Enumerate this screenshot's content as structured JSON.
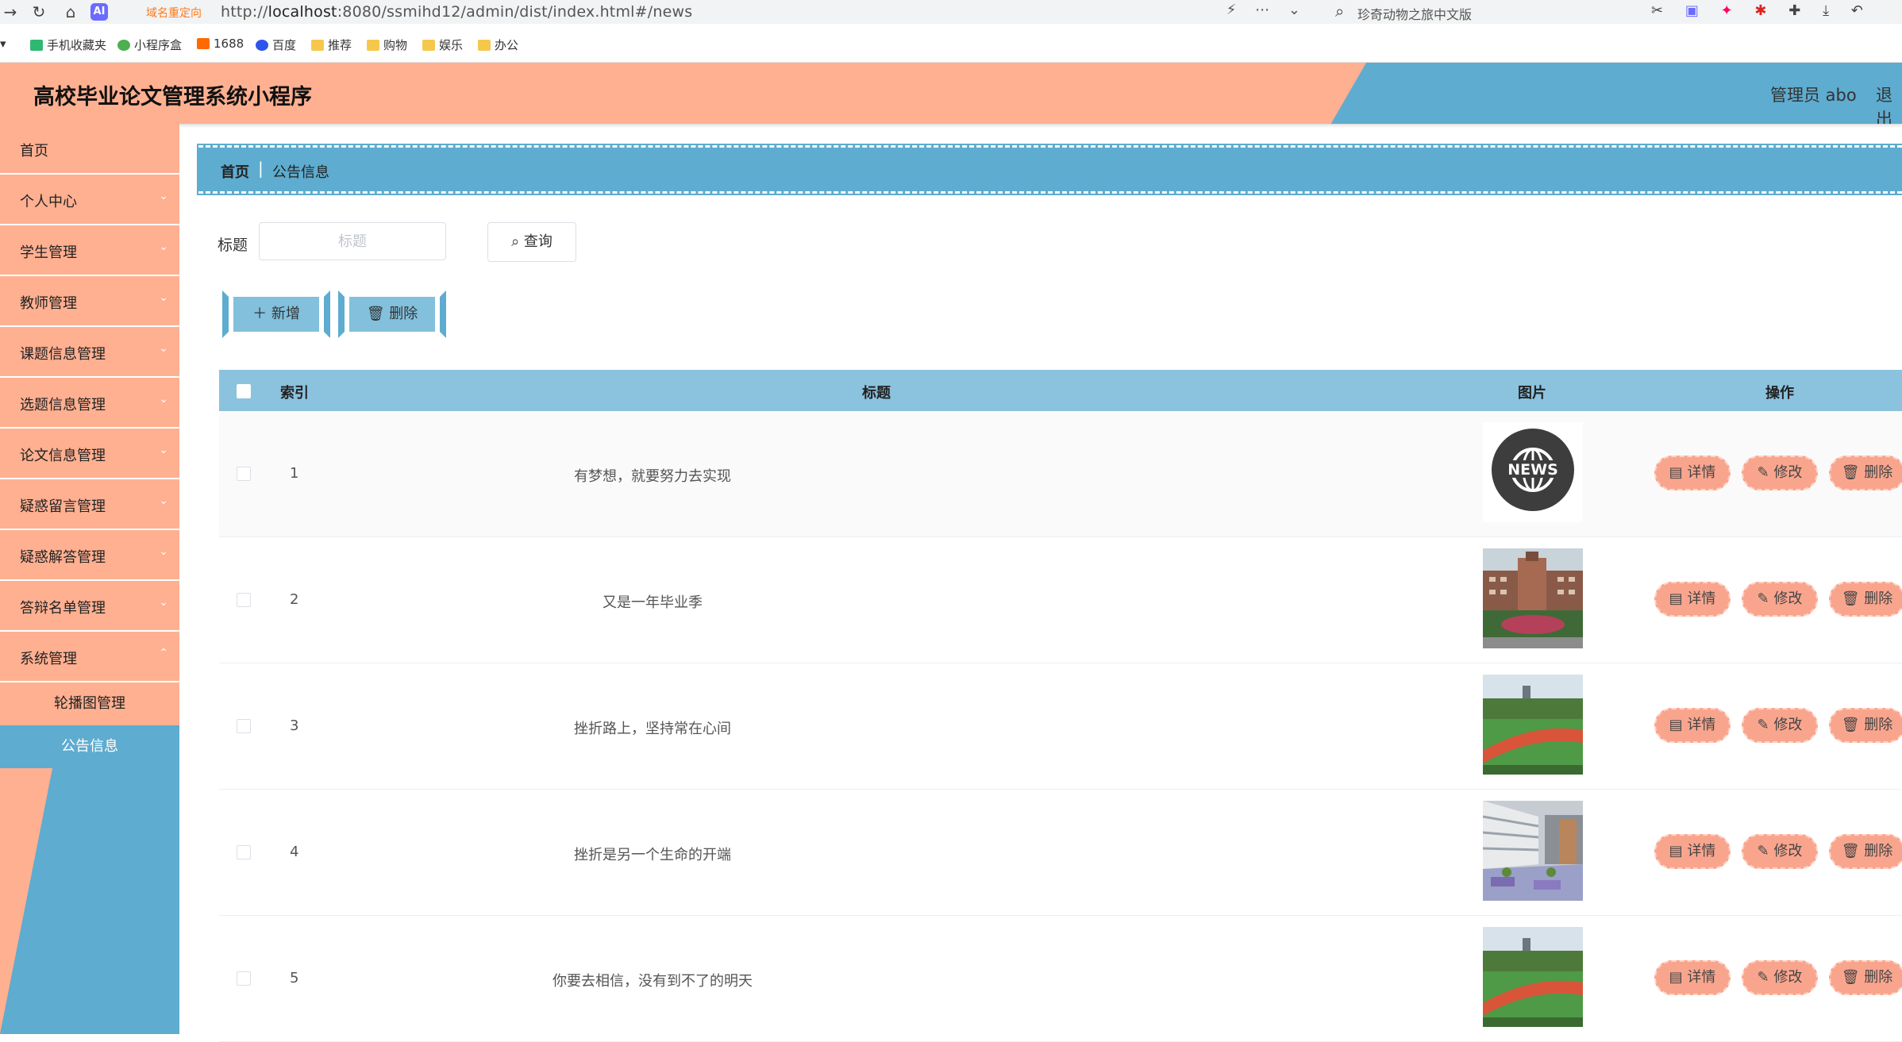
{
  "browser": {
    "redirect_label": "域名重定向",
    "url_prefix": "http://",
    "url_host": "localhost",
    "url_rest": ":8080/ssmihd12/admin/dist/index.html#/news",
    "search_text": "珍奇动物之旅中文版",
    "bookmarks": [
      {
        "label": "手机收藏夹",
        "icon": "phone-icon"
      },
      {
        "label": "小程序盒",
        "icon": "miniapp-icon"
      },
      {
        "label": "1688",
        "icon": "1688-icon"
      },
      {
        "label": "百度",
        "icon": "baidu-icon"
      },
      {
        "label": "推荐",
        "icon": "folder-icon"
      },
      {
        "label": "购物",
        "icon": "folder-icon"
      },
      {
        "label": "娱乐",
        "icon": "folder-icon"
      },
      {
        "label": "办公",
        "icon": "folder-icon"
      }
    ]
  },
  "header": {
    "title": "高校毕业论文管理系统小程序",
    "admin": "管理员 abo",
    "logout": "退出"
  },
  "sidebar": {
    "items": [
      {
        "label": "首页"
      },
      {
        "label": "个人中心"
      },
      {
        "label": "学生管理"
      },
      {
        "label": "教师管理"
      },
      {
        "label": "课题信息管理"
      },
      {
        "label": "选题信息管理"
      },
      {
        "label": "论文信息管理"
      },
      {
        "label": "疑惑留言管理"
      },
      {
        "label": "疑惑解答管理"
      },
      {
        "label": "答辩名单管理"
      },
      {
        "label": "系统管理"
      }
    ],
    "sub_items": [
      {
        "label": "轮播图管理"
      },
      {
        "label": "公告信息"
      }
    ]
  },
  "breadcrumb": {
    "home": "首页",
    "sep": "|",
    "current": "公告信息"
  },
  "search": {
    "label": "标题",
    "placeholder": "标题",
    "query_label": "查询",
    "query_icon": "search-icon"
  },
  "actions": {
    "add_label": "新增",
    "delete_label": "删除"
  },
  "table": {
    "headers": {
      "index": "索引",
      "title": "标题",
      "image": "图片",
      "ops": "操作"
    },
    "op_labels": {
      "detail": "详情",
      "edit": "修改",
      "delete": "删除"
    },
    "rows": [
      {
        "index": "1",
        "title": "有梦想，就要努力去实现",
        "image": "news-globe-icon"
      },
      {
        "index": "2",
        "title": "又是一年毕业季",
        "image": "campus-building-photo"
      },
      {
        "index": "3",
        "title": "挫折路上，坚持常在心间",
        "image": "sports-field-photo"
      },
      {
        "index": "4",
        "title": "挫折是另一个生命的开端",
        "image": "campus-courtyard-photo"
      },
      {
        "index": "5",
        "title": "你要去相信，没有到不了的明天",
        "image": "sports-field-photo"
      }
    ]
  },
  "colors": {
    "peach": "#ffb091",
    "blue": "#5eaccf",
    "header_blue": "#8bc2de"
  }
}
